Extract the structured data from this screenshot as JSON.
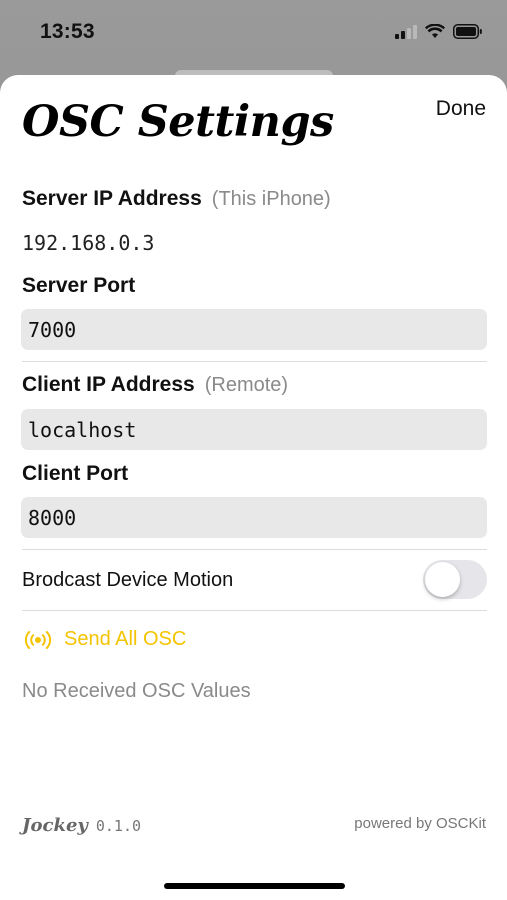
{
  "status_bar": {
    "time": "13:53",
    "icons": [
      "cellular-signal-icon",
      "wifi-icon",
      "battery-icon"
    ]
  },
  "header": {
    "title": "OSC Settings",
    "done_label": "Done"
  },
  "server_ip": {
    "label": "Server IP Address",
    "sublabel": "(This iPhone)",
    "value": "192.168.0.3"
  },
  "server_port": {
    "label": "Server Port",
    "value": "7000"
  },
  "client_ip": {
    "label": "Client IP Address",
    "sublabel": "(Remote)",
    "value": "localhost"
  },
  "client_port": {
    "label": "Client Port",
    "value": "8000"
  },
  "motion": {
    "label": "Brodcast Device Motion",
    "enabled": false
  },
  "send_all": {
    "label": "Send All OSC",
    "icon": "broadcast-icon",
    "color": "#F5C400"
  },
  "received": {
    "text": "No Received OSC Values"
  },
  "footer": {
    "app_name": "Jockey",
    "version": "0.1.0",
    "powered_by": "powered by OSCKit"
  }
}
